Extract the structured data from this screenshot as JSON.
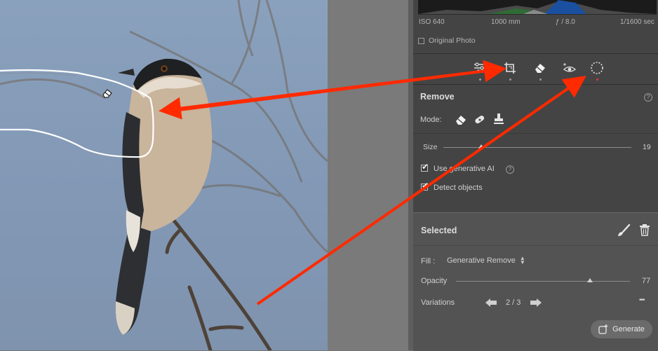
{
  "exif": {
    "iso": "ISO 640",
    "focal": "1000 mm",
    "aperture": "ƒ / 8.0",
    "shutter": "1/1600 sec"
  },
  "original_photo": {
    "label": "Original Photo",
    "checked": false
  },
  "toolbar": {
    "tools": [
      "edit-sliders",
      "crop",
      "remove",
      "red-eye",
      "masking"
    ],
    "active": "remove"
  },
  "remove": {
    "title": "Remove",
    "mode_label": "Mode:",
    "size_label": "Size",
    "size_value": "19",
    "size_level_percent": 20,
    "use_generative_ai": {
      "label": "Use generative AI",
      "checked": true
    },
    "detect_objects": {
      "label": "Detect objects",
      "checked": true
    }
  },
  "selected": {
    "title": "Selected",
    "fill_label": "Fill :",
    "fill_value": "Generative Remove",
    "opacity_label": "Opacity",
    "opacity_value": "77",
    "opacity_level_percent": 77,
    "variations_label": "Variations",
    "variations_value": "2 / 3",
    "more": "•••",
    "generate_label": "Generate"
  },
  "colors": {
    "annotation": "#ff2a00",
    "panel": "#444444",
    "card": "#535353",
    "sky": "#8aa1bd"
  }
}
